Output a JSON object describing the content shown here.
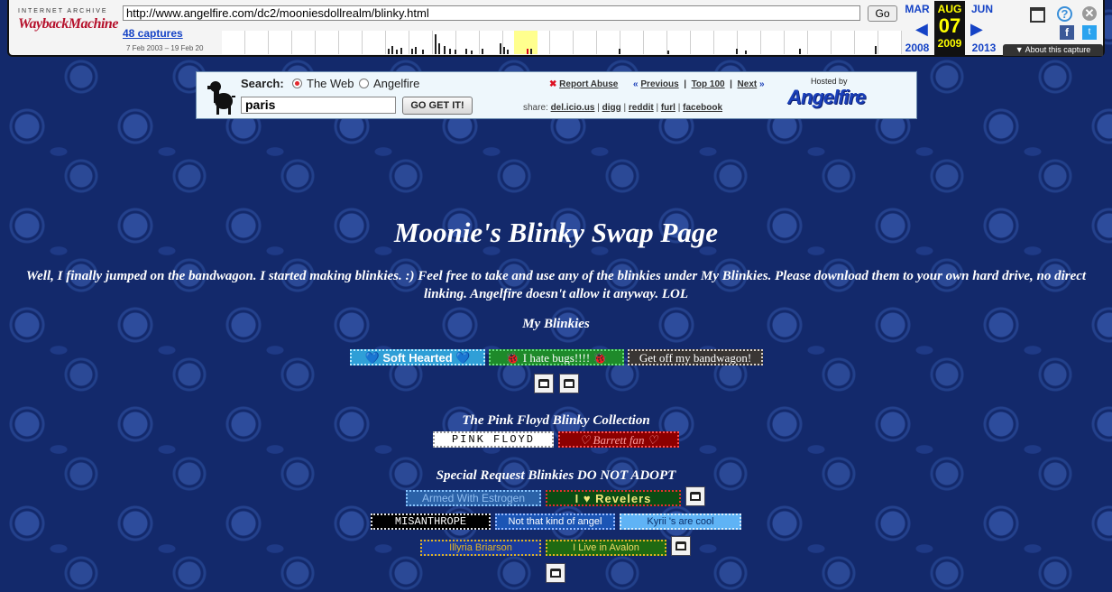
{
  "wayback": {
    "logo_top": "INTERNET ARCHIVE",
    "logo_main": "WaybackMachine",
    "url": "http://www.angelfire.com/dc2/mooniesdollrealm/blinky.html",
    "go_label": "Go",
    "captures": "48 captures",
    "range": "7 Feb 2003 – 19 Feb 20",
    "prev_month": "MAR",
    "prev_year": "2008",
    "cur_month": "AUG",
    "cur_day": "07",
    "cur_year": "2009",
    "next_month": "JUN",
    "next_year": "2013",
    "about": "▼ About this capture"
  },
  "angelfire": {
    "search_label": "Search:",
    "opt_web": "The Web",
    "opt_af": "Angelfire",
    "query": "paris",
    "go_btn": "GO GET IT!",
    "report": "Report Abuse",
    "previous": "Previous",
    "top100": "Top 100",
    "next": "Next",
    "share_label": "share:",
    "share": [
      "del.icio.us",
      "digg",
      "reddit",
      "furl",
      "facebook"
    ],
    "hosted_by": "Hosted by",
    "brand": "Angelfire"
  },
  "page": {
    "title": "Moonie's Blinky Swap Page",
    "intro": "Well, I finally jumped on the bandwagon. I started making blinkies. :) Feel free to take and use any of the blinkies under My Blinkies. Please download them to your own hard drive, no direct linking. Angelfire doesn't allow it anyway. LOL",
    "sec1": "My Blinkies",
    "sec2": "The Pink Floyd Blinky Collection",
    "sec3": "Special Request Blinkies DO NOT ADOPT",
    "b_soft": "💙 Soft Hearted 💙",
    "b_bugs": "🐞 I hate bugs!!!! 🐞",
    "b_band": "Get off my bandwagon!",
    "b_pf": "PINK FLOYD",
    "b_barrett": "♡ Barrett fan ♡",
    "b_estrogen": "Armed With Estrogen",
    "b_revelers": "I ♥ Revelers",
    "b_misan": "MISANTHROPE",
    "b_angel": "Not that kind of angel",
    "b_kyrii": "Kyrii 's are cool",
    "b_illyria": "Illyria Briarson",
    "b_avalon": "I Live in Avalon"
  },
  "colors": {
    "page_bg": "#13296b",
    "link": "#1543c6",
    "cur_date_bg": "#111111"
  }
}
